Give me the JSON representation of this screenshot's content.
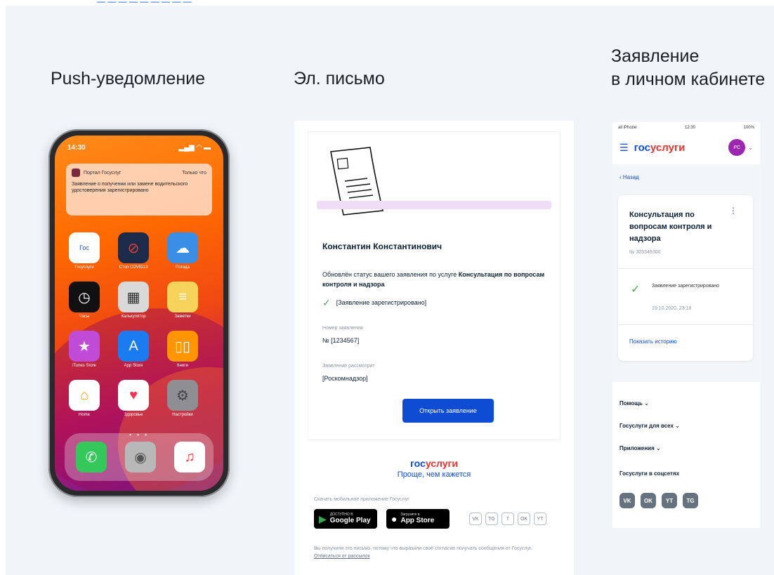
{
  "columns": {
    "push_title": "Push-уведомление",
    "email_title": "Эл. письмо",
    "cabinet_title": "Заявление\nв личном кабинете"
  },
  "phone": {
    "time": "14:30",
    "signal": "▂▄▆ ◠ ▬",
    "notification": {
      "app_name": "Портал Госуслуг",
      "time": "Только что",
      "text": "Заявление о получении или замене водительского удостоверения зарегистрировано"
    },
    "apps": [
      {
        "label": "Госуслуги",
        "icon": "gosuslugi-app-icon",
        "glyph": "Гос"
      },
      {
        "label": "Стоп COVID19",
        "icon": "stop-covid-icon",
        "glyph": "⊘"
      },
      {
        "label": "Погода",
        "icon": "weather-icon",
        "glyph": "☁"
      },
      {
        "label": "Часы",
        "icon": "clock-icon",
        "glyph": "◷"
      },
      {
        "label": "Калькулятор",
        "icon": "calculator-icon",
        "glyph": "▦"
      },
      {
        "label": "Заметки",
        "icon": "notes-icon",
        "glyph": "≡"
      },
      {
        "label": "iTunes Store",
        "icon": "itunes-store-icon",
        "glyph": "★"
      },
      {
        "label": "App Store",
        "icon": "app-store-icon",
        "glyph": "A"
      },
      {
        "label": "Книги",
        "icon": "books-icon",
        "glyph": "▯▯"
      },
      {
        "label": "Home",
        "icon": "home-icon",
        "glyph": "⌂"
      },
      {
        "label": "Здоровье",
        "icon": "health-icon",
        "glyph": "♥"
      },
      {
        "label": "Настройки",
        "icon": "settings-icon",
        "glyph": "⚙"
      }
    ],
    "dock": [
      {
        "icon": "phone-icon",
        "glyph": "✆"
      },
      {
        "icon": "contacts-icon",
        "glyph": "◉"
      },
      {
        "icon": "music-icon",
        "glyph": "♫"
      }
    ]
  },
  "email": {
    "name": "Константин Константинович",
    "text_prefix": "Обновлён статус вашего заявления по услуге ",
    "text_bold": "Консультация по вопросам контроля и надзора",
    "status": "[Заявление зарегистрировано]",
    "number_label": "Номер заявления",
    "number_value": "№ [1234567]",
    "reviewer_label": "Заявление рассмотрит",
    "reviewer_value": "[Роскомнадзор]",
    "open_button": "Открыть заявление",
    "brand_a": "гос",
    "brand_b": "услуги",
    "slogan": "Проще, чем кажется",
    "download_caption": "Скачать мобильное приложение Госуслуг",
    "google_play_small": "ДОСТУПНО В",
    "google_play_big": "Google Play",
    "app_store_small": "Загрузите в",
    "app_store_big": "App Store",
    "social": [
      "VK",
      "TG",
      "f",
      "OK",
      "YT"
    ],
    "footer_text": "Вы получили это письмо, потому что выразили своё согласие получать сообщения от Госуслуг. ",
    "unsubscribe": "Отписаться от рассылок"
  },
  "cabinet": {
    "status_left": "all iPhone",
    "status_time": "12:30",
    "status_right": "100%",
    "brand_a": "гос",
    "brand_b": "услуги",
    "avatar": "PC",
    "back": "‹ Назад",
    "card_title": "Консультация по вопросам контроля и надзора",
    "card_number": "№ 305349300",
    "status_text": "Заявление зарегистрировано",
    "status_date": "19.10.2020, 23:18",
    "history_link": "Показать историю",
    "menu": [
      "Помощь",
      "Госуслуги для всех",
      "Приложения"
    ],
    "social_heading": "Госуслуги в соцсетях",
    "social": [
      "VK",
      "OK",
      "YT",
      "TG"
    ]
  },
  "colors": {
    "brand_blue": "#0d4cd3",
    "brand_red": "#e4372f",
    "check_green": "#4caf50",
    "avatar_purple": "#9c27b0"
  }
}
